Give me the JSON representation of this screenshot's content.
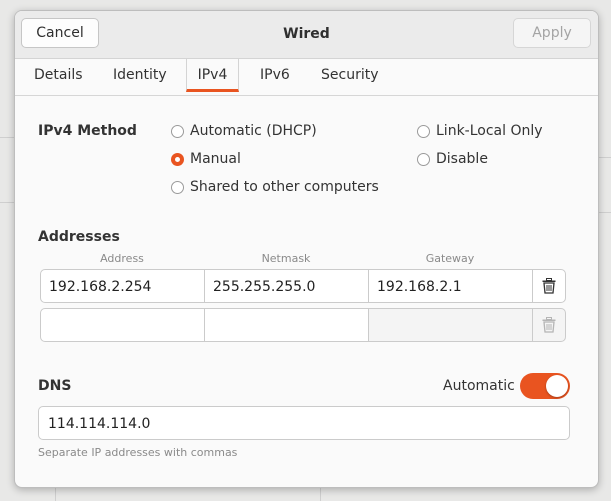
{
  "window": {
    "title": "Wired"
  },
  "header": {
    "cancel_label": "Cancel",
    "apply_label": "Apply"
  },
  "tabs": [
    {
      "label": "Details"
    },
    {
      "label": "Identity"
    },
    {
      "label": "IPv4",
      "active": true
    },
    {
      "label": "IPv6"
    },
    {
      "label": "Security"
    }
  ],
  "ipv4_method": {
    "label": "IPv4 Method",
    "selected": "Manual",
    "options": [
      "Automatic (DHCP)",
      "Manual",
      "Shared to other computers",
      "Link-Local Only",
      "Disable"
    ]
  },
  "addresses": {
    "label": "Addresses",
    "columns": [
      "Address",
      "Netmask",
      "Gateway"
    ],
    "rows": [
      [
        "192.168.2.254",
        "255.255.255.0",
        "192.168.2.1"
      ],
      [
        "",
        "",
        ""
      ]
    ]
  },
  "dns": {
    "label": "DNS",
    "automatic_label": "Automatic",
    "automatic_on": true,
    "value": "114.114.114.0",
    "hint": "Separate IP addresses with commas"
  },
  "colors": {
    "accent": "#e95420"
  },
  "icons": {
    "delete_row": "trash-icon"
  }
}
